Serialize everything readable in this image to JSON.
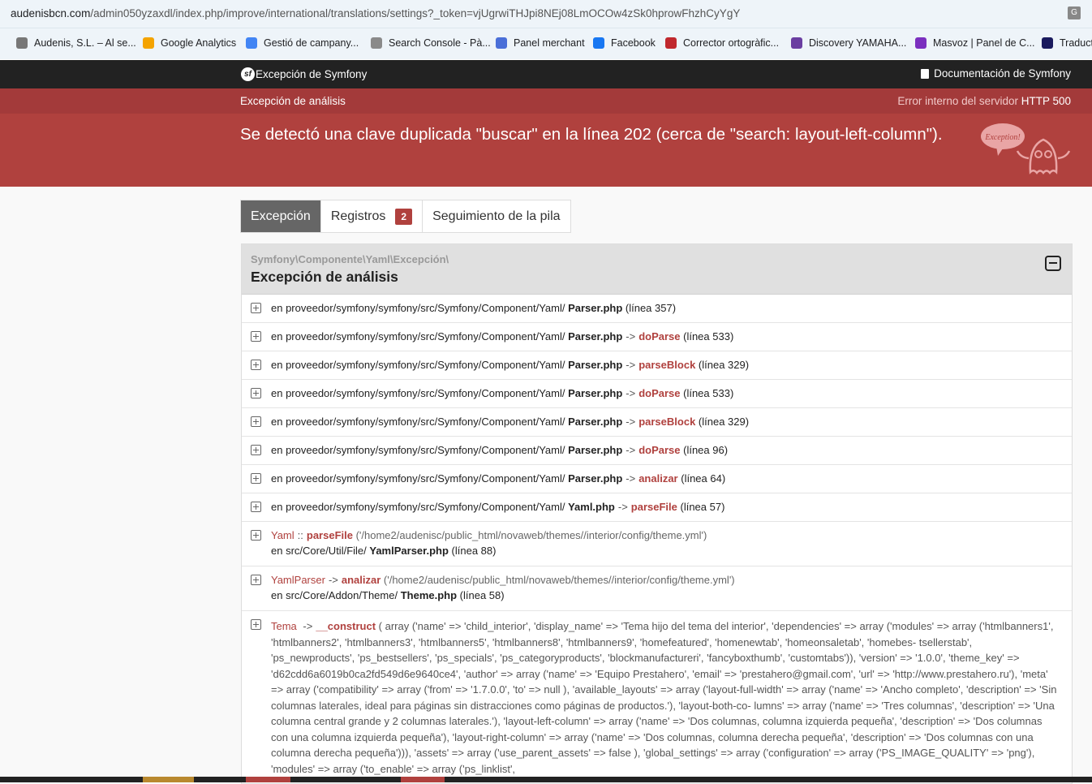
{
  "browser": {
    "url_host": "audenisbcn.com",
    "url_path": "/admin050yzaxdl/index.php/improve/international/translations/settings?_token=vjUgrwiTHJpi8NEj08LmOCOw4zSk0hprowFhzhCyYgY",
    "bookmarks": [
      {
        "label": "Audenis, S.L. – Al se...",
        "icon": "audenis-icon",
        "color": "#777777"
      },
      {
        "label": "Google Analytics",
        "icon": "analytics-icon",
        "color": "#f4a300"
      },
      {
        "label": "Gestió de campany...",
        "icon": "google-ads-icon",
        "color": "#4285f4"
      },
      {
        "label": "Search Console - Pà...",
        "icon": "search-console-icon",
        "color": "#8a8a8a"
      },
      {
        "label": "Panel merchant",
        "icon": "merchant-icon",
        "color": "#4a6fd8"
      },
      {
        "label": "Facebook",
        "icon": "facebook-icon",
        "color": "#1877f2"
      },
      {
        "label": "Corrector ortogràfic...",
        "icon": "corrector-icon",
        "color": "#c0282d"
      },
      {
        "label": "Discovery YAMAHA...",
        "icon": "yamaha-icon",
        "color": "#6a3ea1"
      },
      {
        "label": "Masvoz | Panel de C...",
        "icon": "masvoz-icon",
        "color": "#7b2fbf"
      },
      {
        "label": "Traducto",
        "icon": "translator-icon",
        "color": "#1a1a5e"
      }
    ]
  },
  "header": {
    "brand": "Excepción de Symfony",
    "docs": "Documentación de Symfony",
    "exception_class": "Excepción de análisis",
    "status_text": "Error interno del servidor",
    "status_code": "HTTP 500",
    "message": "Se detectó una clave duplicada \"buscar\" en la línea 202 (cerca de \"search: layout-left-column\").",
    "ghost_label": "Exception!"
  },
  "tabs": {
    "exception": "Excepción",
    "logs": "Registros",
    "logs_count": "2",
    "stack": "Seguimiento de la pila"
  },
  "panel": {
    "namespace": "Symfony\\Componente\\Yaml\\Excepción\\",
    "title": "Excepción de análisis"
  },
  "trace": [
    {
      "prefix": "en proveedor/symfony/symfony/src/Symfony/Component/Yaml/ ",
      "file": "Parser.php",
      "arrow": "",
      "fn": "",
      "line": " (línea 357)"
    },
    {
      "prefix": "en proveedor/symfony/symfony/src/Symfony/Component/Yaml/ ",
      "file": "Parser.php",
      "arrow": "->",
      "fn": "doParse",
      "line": " (línea 533)"
    },
    {
      "prefix": "en proveedor/symfony/symfony/src/Symfony/Component/Yaml/ ",
      "file": "Parser.php",
      "arrow": "->",
      "fn": "parseBlock",
      "line": " (línea 329)"
    },
    {
      "prefix": "en proveedor/symfony/symfony/src/Symfony/Component/Yaml/ ",
      "file": "Parser.php",
      "arrow": "->",
      "fn": "doParse",
      "line": " (línea 533)"
    },
    {
      "prefix": "en proveedor/symfony/symfony/src/Symfony/Component/Yaml/ ",
      "file": "Parser.php",
      "arrow": "->",
      "fn": "parseBlock",
      "line": " (línea 329)"
    },
    {
      "prefix": "en proveedor/symfony/symfony/src/Symfony/Component/Yaml/ ",
      "file": "Parser.php",
      "arrow": "->",
      "fn": "doParse",
      "line": " (línea 96)"
    },
    {
      "prefix": "en proveedor/symfony/symfony/src/Symfony/Component/Yaml/ ",
      "file": "Parser.php",
      "arrow": "->",
      "fn": "analizar",
      "line": " (línea 64)"
    },
    {
      "prefix": "en proveedor/symfony/symfony/src/Symfony/Component/Yaml/ ",
      "file": "Yaml.php",
      "arrow": "->",
      "fn": "parseFile",
      "line": " (línea 57)"
    }
  ],
  "trace2": [
    {
      "cls": "Yaml",
      "arrow": "::",
      "fn": "parseFile",
      "args": " ('/home2/audenisc/public_html/novaweb/themes//interior/config/theme.yml')",
      "prefix": "en src/Core/Util/File/ ",
      "file": "YamlParser.php",
      "line": " (línea 88)"
    },
    {
      "cls": "YamlParser",
      "arrow": "->",
      "fn": "analizar",
      "args": " ('/home2/audenisc/public_html/novaweb/themes//interior/config/theme.yml')",
      "prefix": "en src/Core/Addon/Theme/ ",
      "file": "Theme.php",
      "line": " (línea 58)"
    }
  ],
  "construct": {
    "cls": "Tema",
    "arrow": "->",
    "fn": "__construct",
    "args": " ( array ('name' => 'child_interior', 'display_name' => 'Tema hijo del tema del interior', 'dependencies' => array ('modules' => array ('htmlbanners1', 'htmlbanners2', 'htmlbanners3', 'htmlbanners5', 'htmlbanners8', 'htmlbanners9', 'homefeatured', 'homenewtab', 'homeonsaletab', 'homebes- tsellerstab', 'ps_newproducts', 'ps_bestsellers', 'ps_specials', 'ps_categoryproducts', 'blockmanufactureri', 'fancyboxthumb', 'customtabs')), 'version' => '1.0.0', 'theme_key' => 'd62cdd6a6019b0ca2fd549d6e9640ce4', 'author' => array ('name' => 'Equipo Prestahero', 'email' => 'prestahero@gmail.com', 'url' => 'http://www.prestahero.ru'), 'meta' => array ('compatibility' => array ('from' => '1.7.0.0', 'to' => null ), 'available_layouts' => array ('layout-full-width' => array ('name' => 'Ancho completo', 'description' => 'Sin columnas laterales, ideal para páginas sin distracciones como páginas de productos.'), 'layout-both-co- lumns' => array ('name' => 'Tres columnas', 'description' => 'Una columna central grande y 2 columnas laterales.'), 'layout-left-column' => array ('name' => 'Dos columnas, columna izquierda pequeña', 'description' => 'Dos columnas con una columna izquierda pequeña'), 'layout-right-column' => array ('name' => 'Dos columnas, columna derecha pequeña', 'description' => 'Dos columnas con una columna derecha pequeña'))), 'assets' => array ('use_parent_assets' => false ), 'global_settings' => array ('configuration' => array ('PS_IMAGE_QUALITY' => 'png'), 'modules' => array ('to_enable' => array ('ps_linklist',"
  }
}
